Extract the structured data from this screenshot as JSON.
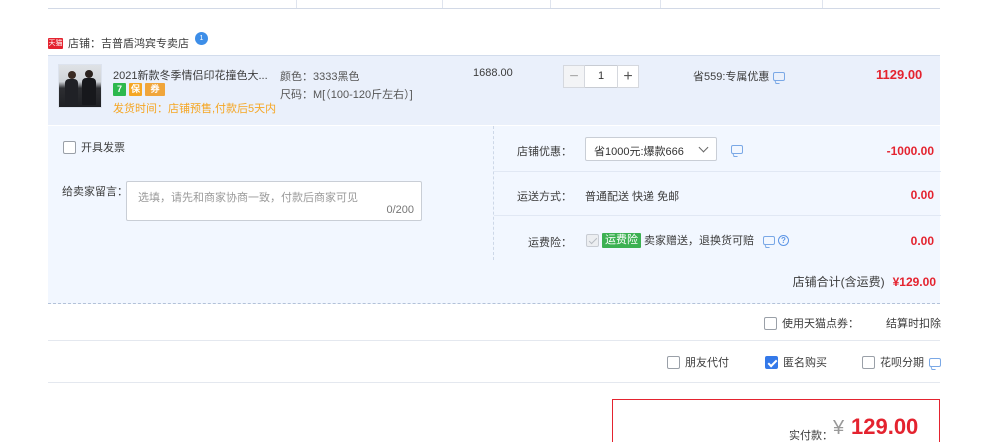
{
  "shop": {
    "badge_text": "天猫",
    "label": "店铺：吉普盾鸿宾专卖店",
    "chat_badge": "1"
  },
  "item": {
    "title": "2021新款冬季情侣印花撞色大...",
    "badges": [
      "7",
      "保",
      "券"
    ],
    "ship_time": "发货时间：店铺预售,付款后5天内",
    "color_attr": "颜色：3333黑色",
    "size_attr": "尺码：M[（100-120斤左右）]",
    "unit_price": "1688.00",
    "quantity": "1",
    "qty_minus": "−",
    "qty_plus": "+",
    "promo": "省559:专属优惠",
    "subtotal": "1129.00"
  },
  "options": {
    "invoice_label": "开具发票",
    "message_label": "给卖家留言：",
    "message_placeholder": "选填，请先和商家协商一致，付款后商家可见",
    "message_count": "0/200"
  },
  "summary": {
    "shop_discount_label": "店铺优惠：",
    "shop_discount_value": "省1000元:爆款666",
    "shop_discount_amount": "-1000.00",
    "shipping_label": "运送方式：",
    "shipping_value": "普通配送 快递 免邮",
    "shipping_amount": "0.00",
    "insurance_label": "运费险：",
    "insurance_tag": "运费险",
    "insurance_text": "卖家赠送，退换货可赔",
    "insurance_help": "?",
    "insurance_amount": "0.00",
    "shop_total_label": "店铺合计(含运费)",
    "shop_total_value": "¥129.00"
  },
  "payment": {
    "tmall_points_label": "使用天猫点券：",
    "tmall_points_value": "结算时扣除",
    "friend_pay_label": "朋友代付",
    "anonymous_label": "匿名购买",
    "huabei_label": "花呗分期",
    "actual_label": "实付款：",
    "currency": "¥",
    "actual_amount": "129.00"
  },
  "colors": {
    "accent_red": "#e4232f",
    "link_blue": "#3479e9",
    "panel_bg": "#eaf0fb"
  }
}
